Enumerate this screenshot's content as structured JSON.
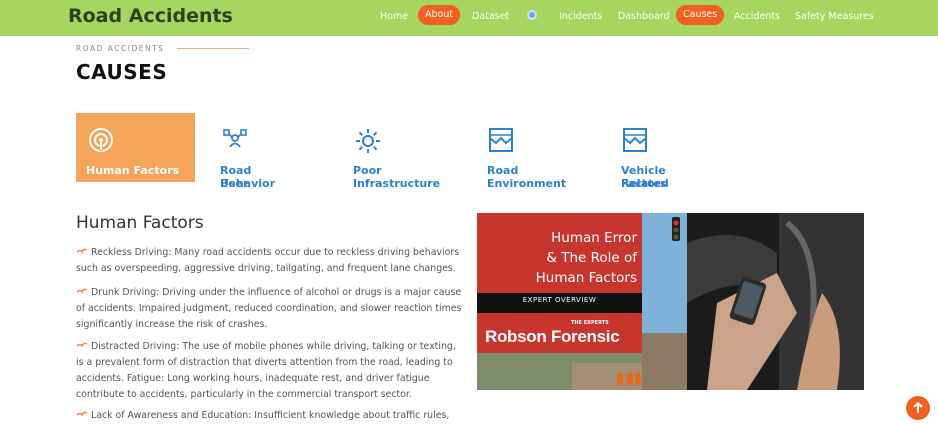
{
  "brand": "Road Accidents",
  "nav": {
    "items": [
      "Home",
      "About",
      "Dataset",
      "Incidents",
      "Dashboard",
      "Causes",
      "Accidents",
      "Safety Measures"
    ]
  },
  "eyebrow": "ROAD ACCIDENTS",
  "page_title": "CAUSES",
  "tabs": [
    {
      "label": "Human Factors",
      "icon": "signal-icon",
      "active": true
    },
    {
      "label_lines": [
        "Road User",
        "Behavior"
      ],
      "icon": "user-network-icon"
    },
    {
      "label_lines": [
        "Poor",
        "Infrastructure"
      ],
      "icon": "sun-icon"
    },
    {
      "label": "Road Environment",
      "icon": "landscape-icon"
    },
    {
      "label_lines": [
        "Vehicle Related",
        "Factors"
      ],
      "icon": "landscape-icon"
    }
  ],
  "section_title": "Human Factors",
  "paragraphs": [
    "Reckless Driving: Many road accidents occur due to reckless driving behaviors such as overspeeding, aggressive driving, tailgating, and frequent lane changes.",
    "Drunk Driving: Driving under the influence of alcohol or drugs is a major cause of accidents. Impaired judgment, reduced coordination, and slower reaction times significantly increase the risk of crashes.",
    "Distracted Driving: The use of mobile phones while driving, talking or texting, is a prevalent form of distraction that diverts attention from the road, leading to accidents. Fatigue: Long working hours, inadequate rest, and driver fatigue contribute to accidents, particularly in the commercial transport sector.",
    "Lack of Awareness and Education: Insufficient knowledge about traffic rules,"
  ],
  "photo": {
    "headline_lines": [
      "Human Error",
      "& The Role of",
      "Human Factors"
    ],
    "subtitle": "EXPERT OVERVIEW",
    "tagline": "THE EXPERTS",
    "company": "Robson Forensic"
  },
  "colors": {
    "topbar": "#a6d65f",
    "accent": "#f0601f",
    "tab_active": "#f4a35a",
    "link": "#2f7fd4"
  }
}
